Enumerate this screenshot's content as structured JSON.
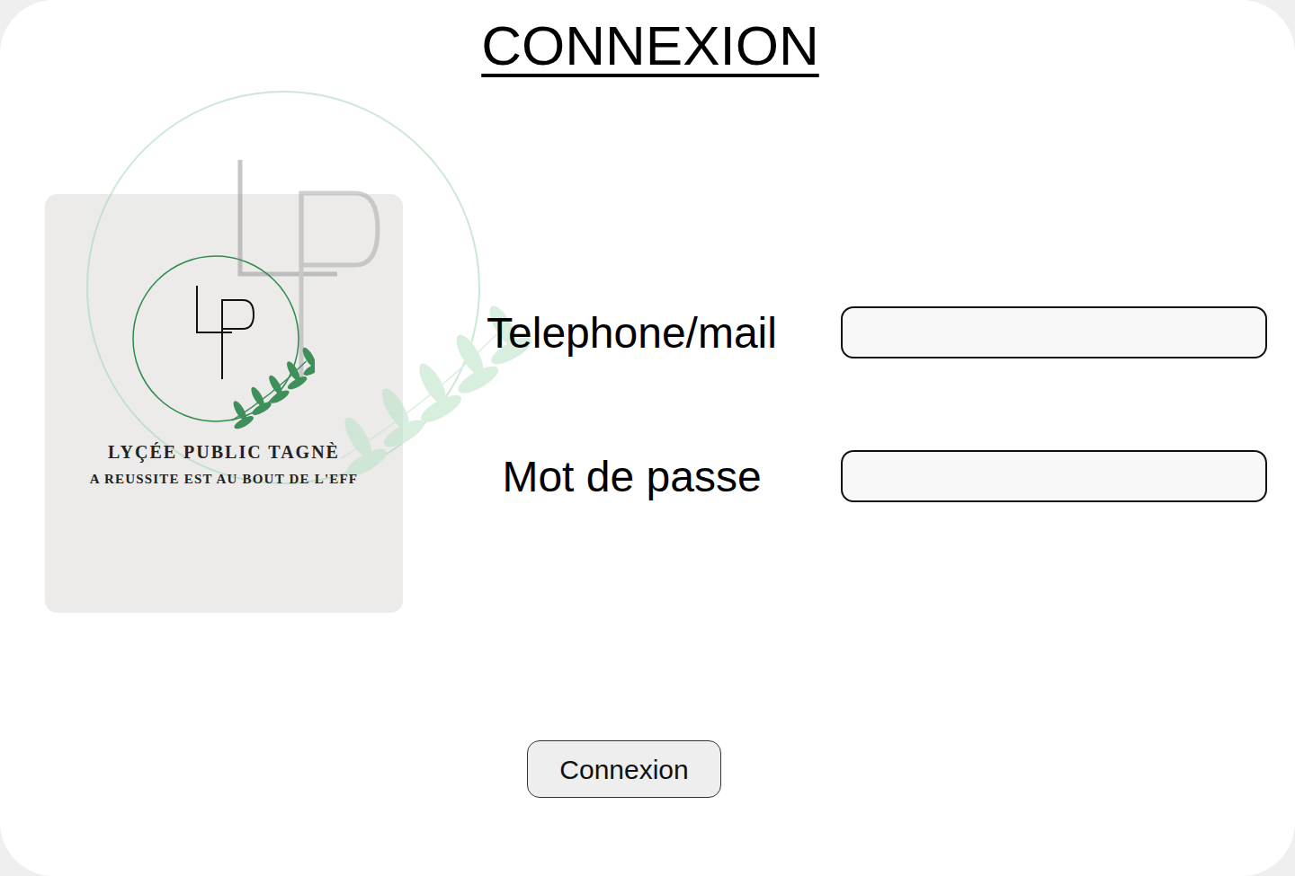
{
  "title": "CONNEXION",
  "logo": {
    "name": "LYÇÉE PUBLIC TAGNÈ",
    "motto": "A REUSSITE EST AU BOUT DE L'EFF"
  },
  "form": {
    "fields": [
      {
        "label": "Telephone/mail",
        "kind": "text"
      },
      {
        "label": "Mot de passe",
        "kind": "password"
      }
    ]
  },
  "buttons": [
    "Connexion"
  ]
}
